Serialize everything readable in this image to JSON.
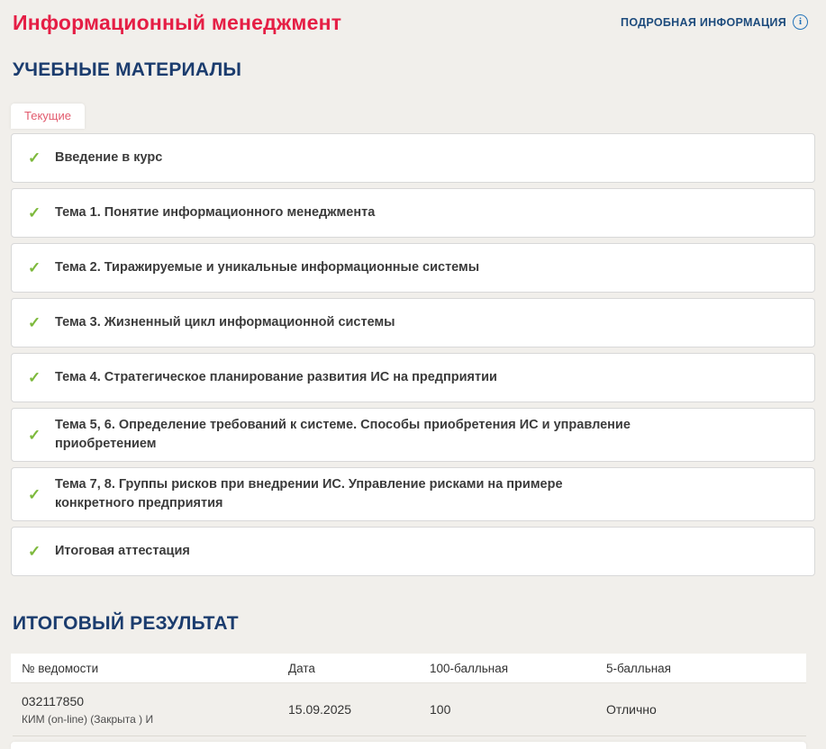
{
  "header": {
    "title": "Информационный менеджмент",
    "details_link_label": "ПОДРОБНАЯ ИНФОРМАЦИЯ"
  },
  "icons": {
    "check": "✓",
    "info": "i"
  },
  "materials": {
    "heading": "УЧЕБНЫЕ МАТЕРИАЛЫ",
    "active_tab": "Текущие",
    "items": [
      {
        "label": "Введение в курс",
        "status": "completed"
      },
      {
        "label": "Тема 1. Понятие информационного менеджмента",
        "status": "completed"
      },
      {
        "label": "Тема 2. Тиражируемые и уникальные информационные системы",
        "status": "completed"
      },
      {
        "label": "Тема 3. Жизненный цикл информационной системы",
        "status": "completed"
      },
      {
        "label": "Тема 4. Стратегическое планирование развития ИС на предприятии",
        "status": "completed"
      },
      {
        "label": "Тема 5, 6. Определение требований к системе. Способы приобретения ИС и управление приобретением",
        "status": "completed"
      },
      {
        "label": "Тема 7, 8. Группы рисков при внедрении ИС. Управление рисками на примере конкретного предприятия",
        "status": "completed"
      },
      {
        "label": "Итоговая аттестация",
        "status": "completed"
      }
    ]
  },
  "result": {
    "heading": "ИТОГОВЫЙ РЕЗУЛЬТАТ",
    "table": {
      "headers": [
        "№ ведомости",
        "Дата",
        "100-балльная",
        "5-балльная"
      ],
      "rows": [
        {
          "vedomost": "032117850",
          "vedomost_sub": "КИМ (on-line) (Закрыта ) И",
          "date": "15.09.2025",
          "score_100": "100",
          "score_5": "Отлично"
        }
      ]
    }
  },
  "colors": {
    "page_background": "#f1efeb",
    "title_red": "#e51e45",
    "heading_navy": "#1b3c6e",
    "link_navy": "#1d4b7c",
    "info_blue": "#2373b9",
    "tab_red": "#e25a6d",
    "check_green": "#7db93c",
    "card_border": "#d8d8d8"
  }
}
